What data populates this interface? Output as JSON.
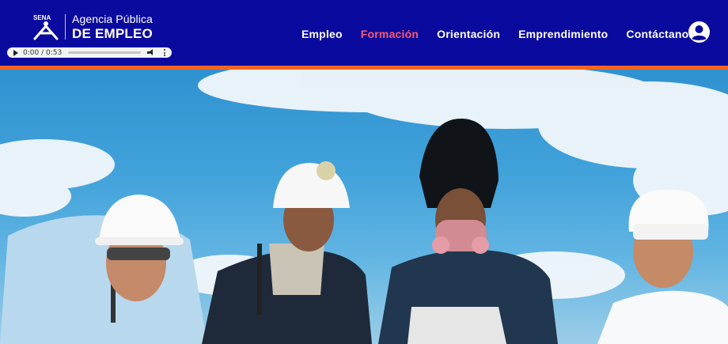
{
  "header": {
    "logo": {
      "brand_mark": "SENA",
      "line1": "Agencia Pública",
      "line2": "DE EMPLEO"
    },
    "audio": {
      "time": "0:00 / 0:53",
      "progress": 0
    },
    "nav": {
      "items": [
        {
          "label": "Empleo",
          "active": false
        },
        {
          "label": "Formación",
          "active": true
        },
        {
          "label": "Orientación",
          "active": false
        },
        {
          "label": "Emprendimiento",
          "active": false
        },
        {
          "label": "Contáctanos",
          "active": false
        }
      ]
    },
    "user_icon": "user-circle-icon"
  },
  "colors": {
    "header_bg": "#0b0a9e",
    "accent_bar": "#f26522",
    "nav_active": "#ff5a6e",
    "nav_text": "#ffffff"
  }
}
